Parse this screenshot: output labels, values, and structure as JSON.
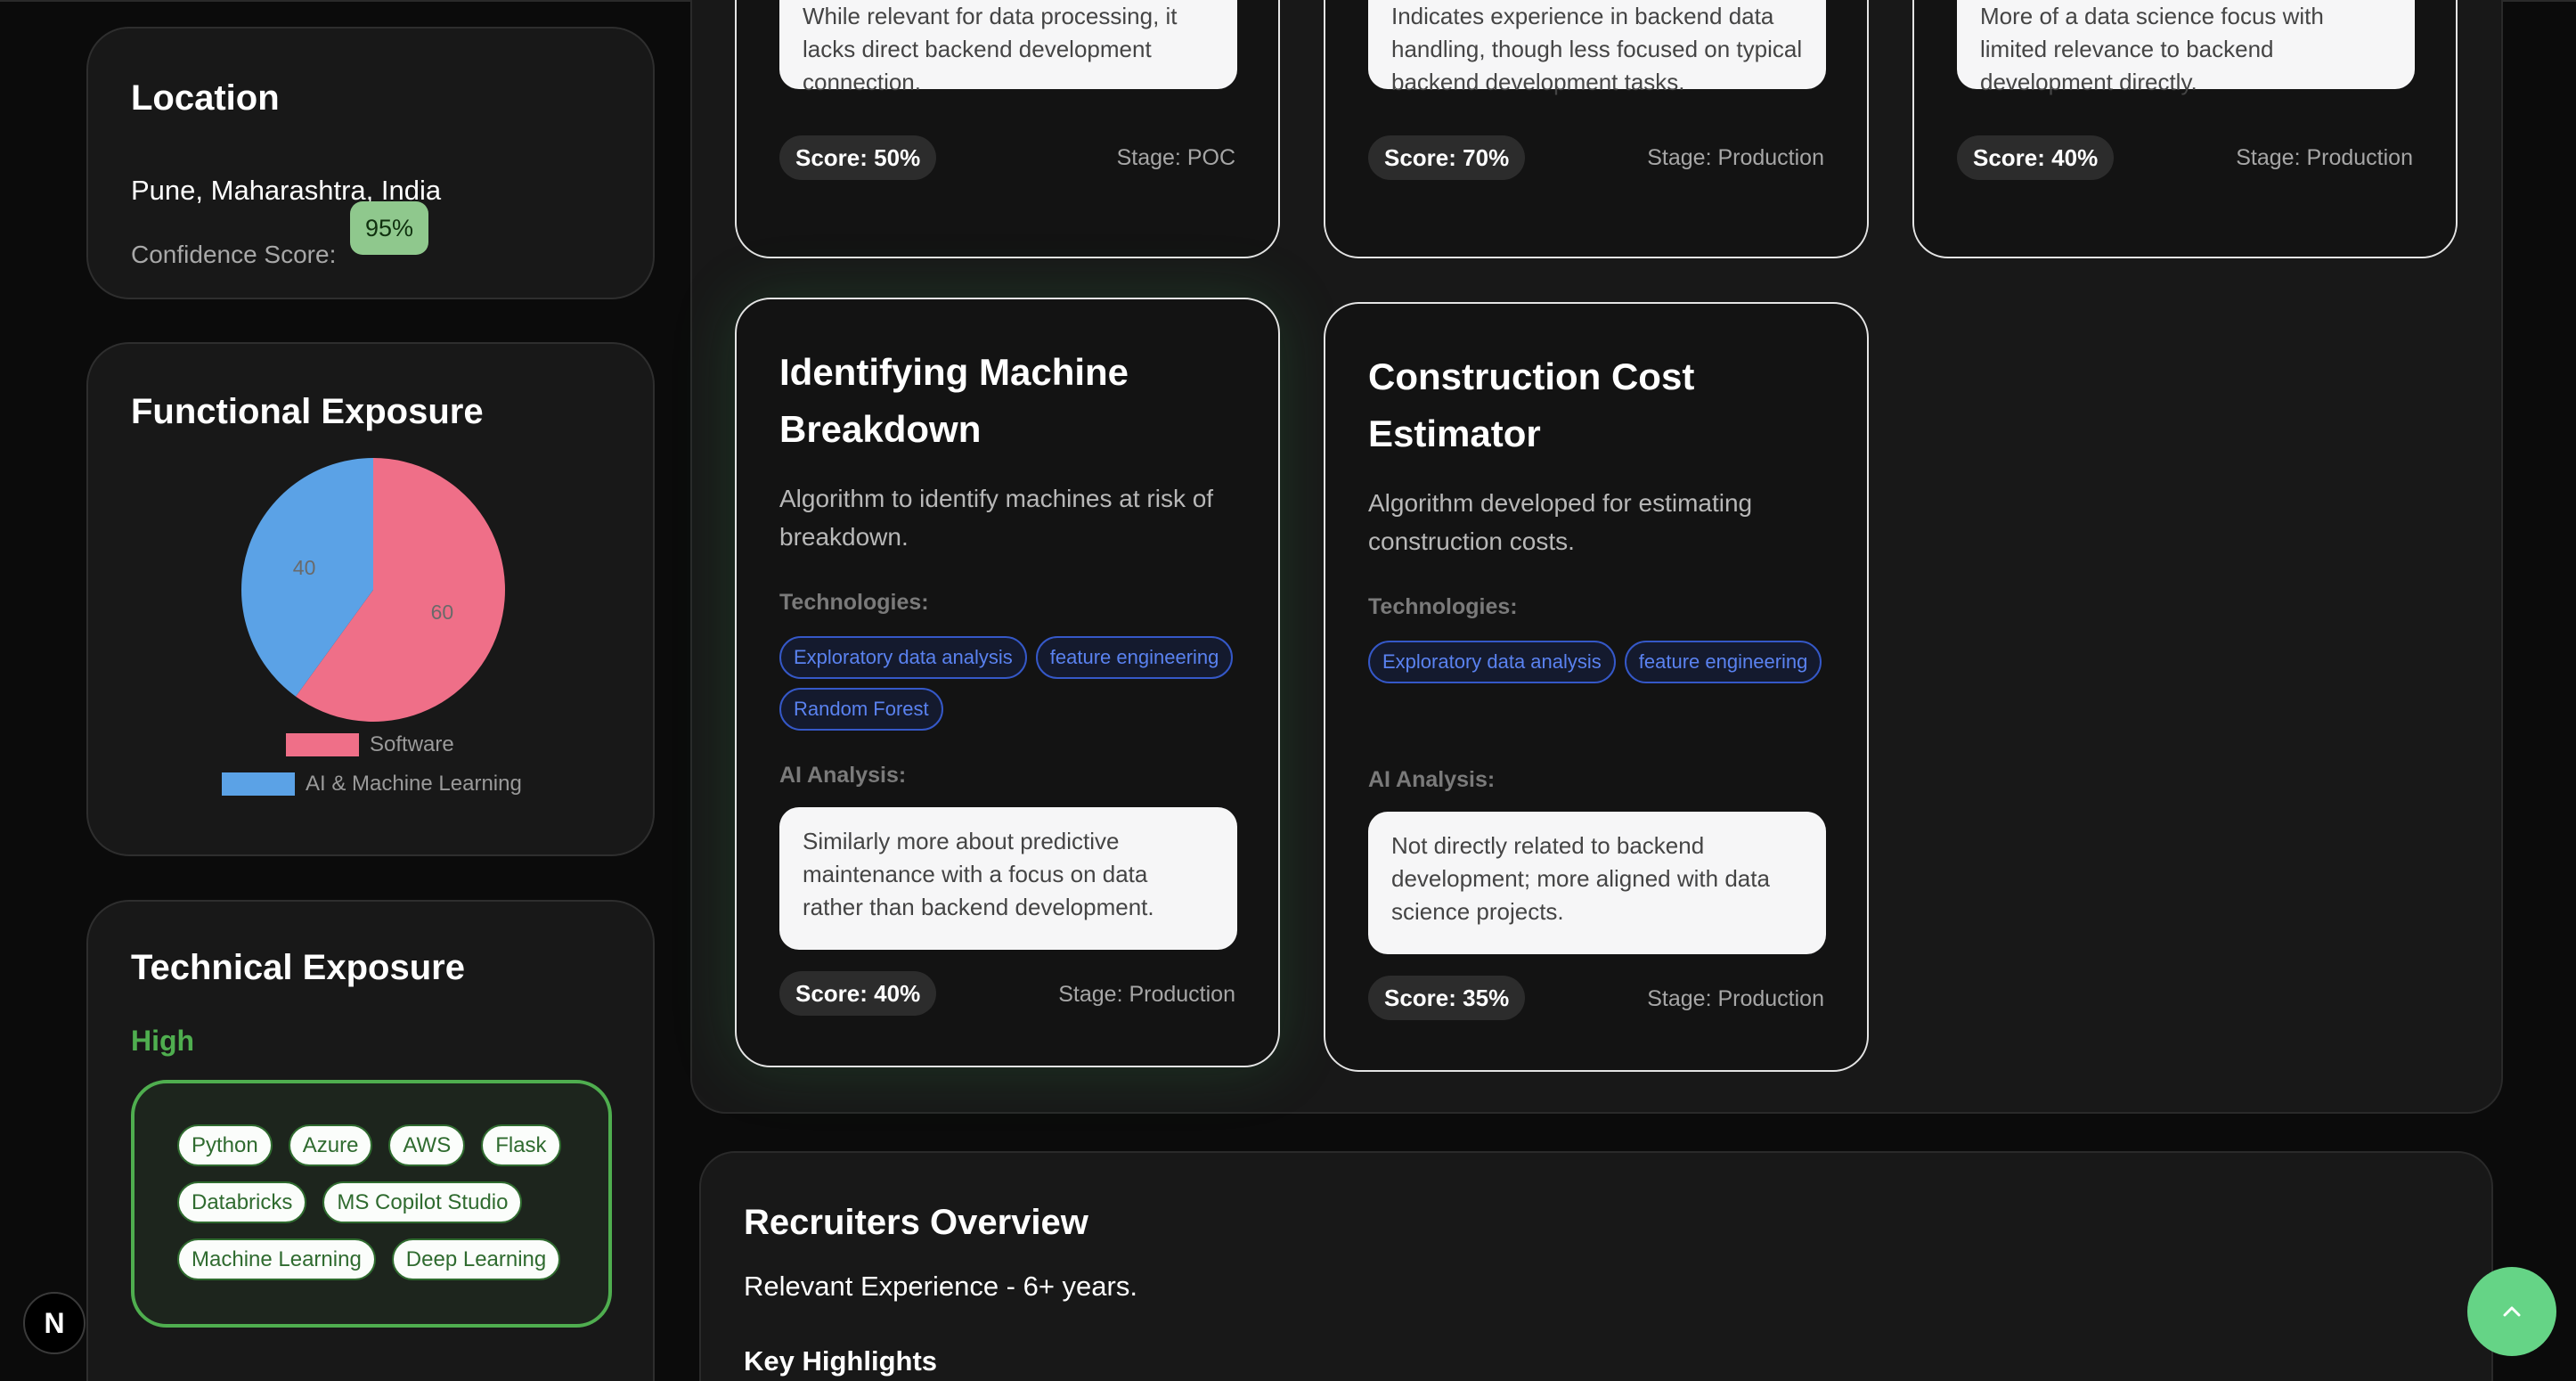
{
  "location": {
    "title": "Location",
    "value": "Pune, Maharashtra, India",
    "confidence_label": "Confidence Score:",
    "confidence_value": "95%"
  },
  "functional": {
    "title": "Functional Exposure",
    "chart_data": {
      "type": "pie",
      "categories": [
        "Software",
        "AI & Machine Learning"
      ],
      "values": [
        60,
        40
      ],
      "colors": [
        "#ef6f88",
        "#5ba2e6"
      ],
      "labels": [
        "60",
        "40"
      ],
      "legend": "bottom"
    }
  },
  "technical": {
    "title": "Technical Exposure",
    "level": "High",
    "tags": [
      "Python",
      "Azure",
      "AWS",
      "Flask",
      "Databricks",
      "MS Copilot Studio",
      "Machine Learning",
      "Deep Learning"
    ]
  },
  "projects": {
    "tech_label": "Technologies:",
    "analysis_label": "AI Analysis:",
    "top_row": [
      {
        "analysis": "While relevant for data processing, it lacks direct backend development connection.",
        "score": "Score: 50%",
        "stage": "Stage: POC"
      },
      {
        "analysis": "Indicates experience in backend data handling, though less focused on typical backend development tasks.",
        "score": "Score: 70%",
        "stage": "Stage: Production"
      },
      {
        "analysis": "More of a data science focus with limited relevance to backend development directly.",
        "score": "Score: 40%",
        "stage": "Stage: Production"
      }
    ],
    "cards": [
      {
        "title": "Identifying Machine Breakdown",
        "description": "Algorithm to identify machines at risk of breakdown.",
        "technologies": [
          "Exploratory data analysis",
          "feature engineering",
          "Random Forest"
        ],
        "analysis": "Similarly more about predictive maintenance with a focus on data rather than backend development.",
        "score": "Score: 40%",
        "stage": "Stage: Production"
      },
      {
        "title": "Construction Cost Estimator",
        "description": "Algorithm developed for estimating construction costs.",
        "technologies": [
          "Exploratory data analysis",
          "feature engineering"
        ],
        "analysis": "Not directly related to backend development; more aligned with data science projects.",
        "score": "Score: 35%",
        "stage": "Stage: Production"
      }
    ]
  },
  "recruiters": {
    "title": "Recruiters Overview",
    "experience": "Relevant Experience - 6+ years.",
    "key_highlights": "Key Highlights"
  },
  "floating": {
    "framework_badge": "N",
    "scroll_top_icon": "chevron-up-icon"
  }
}
